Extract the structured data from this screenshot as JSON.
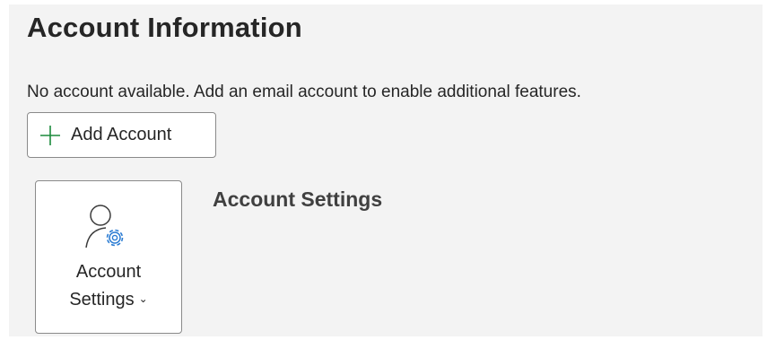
{
  "page": {
    "title": "Account Information",
    "info_text": "No account available. Add an email account to enable additional features."
  },
  "add_account": {
    "label": "Add Account",
    "icon": "plus-icon"
  },
  "account_settings": {
    "tile_label_line1": "Account",
    "tile_label_line2": "Settings",
    "dropdown_indicator": "⌄",
    "icon": "account-settings-icon",
    "heading": "Account Settings"
  },
  "colors": {
    "panel_background": "#f3f3f3",
    "text": "#262626",
    "plus_green": "#1b8a3c",
    "gear_blue": "#2b7cd3",
    "border": "#8a8a8a"
  }
}
